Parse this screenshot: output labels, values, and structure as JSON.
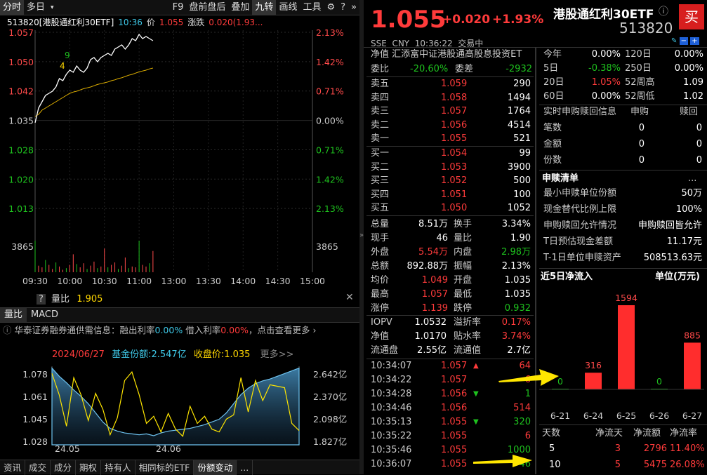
{
  "toolbar": {
    "items": [
      "分时",
      "多日",
      "F9",
      "盘前盘后",
      "叠加",
      "九转",
      "画线",
      "工具"
    ],
    "selected": "分时",
    "icons": [
      "gear-icon",
      "help-icon",
      "double-chevron-icon"
    ]
  },
  "chart": {
    "header_code": "513820[港股通红利30ETF]",
    "time": "10:36",
    "price_label": "价",
    "price": "1.055",
    "change_label": "涨跌",
    "change": "0.020(1.93...",
    "price_ticks": [
      "1.057",
      "1.050",
      "1.042",
      "1.035",
      "1.028",
      "1.020",
      "1.013"
    ],
    "pct_ticks": [
      "2.13%",
      "1.42%",
      "0.71%",
      "0.00%",
      "0.71%",
      "1.42%",
      "2.13%"
    ],
    "volume_tick": "3865",
    "time_ticks": [
      "09:30",
      "10:00",
      "10:30",
      "11:00",
      "13:00",
      "13:30",
      "14:00",
      "14:30",
      "15:00"
    ],
    "markers": [
      "9",
      "4"
    ],
    "price_series": [
      1.0355,
      1.039,
      1.0405,
      1.042,
      1.0425,
      1.043,
      1.044,
      1.046,
      1.0455,
      1.047,
      1.048,
      1.0475,
      1.049,
      1.048,
      1.0475,
      1.0485,
      1.0505,
      1.051,
      1.05,
      1.051,
      1.0515,
      1.052,
      1.0515,
      1.053,
      1.0535,
      1.054,
      1.053,
      1.054,
      1.0555,
      1.055,
      1.0565,
      1.0555,
      1.056,
      1.0555,
      1.055
    ],
    "avg_series": [
      1.037,
      1.0375,
      1.0385,
      1.039,
      1.0395,
      1.04,
      1.0405,
      1.041,
      1.0415,
      1.042,
      1.0425,
      1.0428,
      1.043,
      1.0433,
      1.0436,
      1.0438,
      1.044,
      1.0443,
      1.0446,
      1.0448,
      1.045,
      1.0452,
      1.0455,
      1.0457,
      1.046,
      1.0462,
      1.0465,
      1.0468,
      1.047,
      1.0473,
      1.0476,
      1.0478,
      1.048,
      1.0483,
      1.0485
    ],
    "volumes": [
      3865,
      800,
      600,
      1500,
      900,
      400,
      1200,
      700,
      300,
      500,
      900,
      2200,
      1000,
      600,
      1100,
      400,
      800,
      1300,
      500,
      700,
      2900,
      600,
      900,
      1200,
      400,
      800,
      1800,
      500,
      700,
      600,
      3865,
      900,
      700,
      1100,
      2600
    ]
  },
  "indicator": {
    "tabs": [
      "量比",
      "MACD"
    ],
    "selected": "量比",
    "label": "量比",
    "value": "1.905"
  },
  "news": {
    "text": "华泰证券融券通供需信息：融出利率",
    "rate1": "0.00%",
    "mid": "借入利率",
    "rate2": "0.00%",
    "tail": "点击查看更多"
  },
  "fund": {
    "date": "2024/06/27",
    "share_label": "基金份额:2.547亿",
    "close_label": "收盘价:1.035",
    "more": "更多>>",
    "left_ticks": [
      "1.078",
      "1.061",
      "1.045",
      "1.028"
    ],
    "right_ticks": [
      "2.642亿",
      "2.370亿",
      "2.098亿",
      "1.827亿"
    ],
    "x_ticks": [
      "24.05",
      "24.06"
    ],
    "share_series": [
      2.64,
      2.55,
      2.48,
      2.4,
      2.33,
      2.25,
      2.15,
      2.05,
      1.98,
      1.95,
      1.93,
      1.92,
      1.91,
      1.92,
      1.9,
      1.93,
      1.95,
      1.96,
      1.97,
      1.98,
      2.0,
      2.02,
      2.05,
      2.08,
      2.15,
      2.25,
      2.35,
      2.42,
      2.47,
      2.5,
      2.52,
      2.55,
      2.58,
      2.61,
      2.64
    ],
    "price_series": [
      1.075,
      1.06,
      1.038,
      1.072,
      1.06,
      1.042,
      1.061,
      1.05,
      1.032,
      1.044,
      1.07,
      1.076,
      1.06,
      1.04,
      1.045,
      1.034,
      1.047,
      1.036,
      1.031,
      1.052,
      1.04,
      1.045,
      1.036,
      1.034,
      1.043,
      1.046,
      1.072,
      1.048,
      1.07,
      1.056,
      1.067,
      1.066,
      1.065,
      1.04,
      1.035
    ]
  },
  "bottom_tabs": [
    "资讯",
    "成交",
    "成分",
    "期权",
    "持有人",
    "相同标的ETF",
    "份额变动",
    "..."
  ],
  "bottom_selected": "份额变动",
  "quote": {
    "price": "1.055",
    "change": "+0.020",
    "pct": "+1.93%",
    "name": "港股通红利30ETF",
    "code": "513820",
    "buy_button": "买",
    "meta": "SSE  CNY  10:36:22  交易中"
  },
  "order_book": {
    "title": "净值 汇添富中证港股通高股息投资ET",
    "wb_label": "委比",
    "wb": "-20.60%",
    "wc_label": "委差",
    "wc": "-2932",
    "asks": [
      [
        "卖五",
        "1.059",
        "290"
      ],
      [
        "卖四",
        "1.058",
        "1494"
      ],
      [
        "卖三",
        "1.057",
        "1764"
      ],
      [
        "卖二",
        "1.056",
        "4514"
      ],
      [
        "卖一",
        "1.055",
        "521"
      ]
    ],
    "bids": [
      [
        "买一",
        "1.054",
        "99"
      ],
      [
        "买二",
        "1.053",
        "3900"
      ],
      [
        "买三",
        "1.052",
        "500"
      ],
      [
        "买四",
        "1.051",
        "100"
      ],
      [
        "买五",
        "1.050",
        "1052"
      ]
    ]
  },
  "stats": [
    [
      "总量",
      "8.51万",
      "换手",
      "3.34%"
    ],
    [
      "现手",
      "46",
      "量比",
      "1.90"
    ],
    [
      "外盘",
      "5.54万",
      "内盘",
      "2.98万"
    ],
    [
      "总额",
      "892.88万",
      "振幅",
      "2.13%"
    ],
    [
      "均价",
      "1.049",
      "开盘",
      "1.035"
    ],
    [
      "最高",
      "1.057",
      "最低",
      "1.035"
    ],
    [
      "涨停",
      "1.139",
      "跌停",
      "0.932"
    ]
  ],
  "stats2": [
    [
      "IOPV",
      "1.0532",
      "溢折率",
      "0.17%"
    ],
    [
      "净值",
      "1.0170",
      "贴水率",
      "3.74%"
    ],
    [
      "流通盘",
      "2.55亿",
      "流通值",
      "2.7亿"
    ]
  ],
  "ticks": [
    [
      "10:34:07",
      "1.057",
      "64",
      "up"
    ],
    [
      "10:34:22",
      "1.057",
      "6",
      ""
    ],
    [
      "10:34:28",
      "1.056",
      "1",
      "down"
    ],
    [
      "10:34:46",
      "1.056",
      "514",
      ""
    ],
    [
      "10:35:13",
      "1.055",
      "320",
      "down"
    ],
    [
      "10:35:22",
      "1.055",
      "6",
      ""
    ],
    [
      "10:35:46",
      "1.055",
      "1000",
      ""
    ],
    [
      "10:36:07",
      "1.055",
      "46",
      ""
    ]
  ],
  "perf": [
    [
      "今年",
      "0.00%",
      "120日",
      "0.00%"
    ],
    [
      "5日",
      "-0.38%",
      "250日",
      "0.00%"
    ],
    [
      "20日",
      "1.05%",
      "52周高",
      "1.09"
    ],
    [
      "60日",
      "0.00%",
      "52周低",
      "1.02"
    ]
  ],
  "redeem": {
    "header": [
      "实时申购赎回信息",
      "申购",
      "赎回"
    ],
    "rows": [
      [
        "笔数",
        "0",
        "0"
      ],
      [
        "金额",
        "0",
        "0"
      ],
      [
        "份数",
        "0",
        "0"
      ]
    ]
  },
  "list": {
    "title": "申赎清单",
    "more": "...",
    "rows": [
      [
        "最小申赎单位份额",
        "50万"
      ],
      [
        "现金替代比例上限",
        "100%"
      ],
      [
        "申购赎回允许情况",
        "申购赎回皆允许"
      ],
      [
        "T日预估现金差额",
        "11.17元"
      ],
      [
        "T-1日单位申赎资产",
        "508513.63元"
      ]
    ]
  },
  "flow": {
    "title": "近5日净流入",
    "unit": "单位(万元)",
    "chart_data": {
      "type": "bar",
      "categories": [
        "6-21",
        "6-24",
        "6-25",
        "6-26",
        "6-27"
      ],
      "values": [
        0,
        316,
        1594,
        0,
        885
      ]
    },
    "table_header": [
      "天数",
      "净流天",
      "净流额",
      "净流率"
    ],
    "table_rows": [
      [
        "5",
        "3",
        "2796",
        "11.40%"
      ],
      [
        "10",
        "5",
        "5475",
        "26.08%"
      ]
    ]
  }
}
